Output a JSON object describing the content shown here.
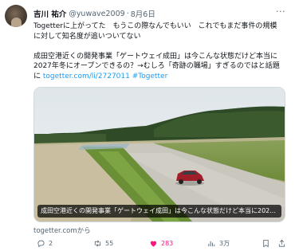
{
  "author": {
    "display_name": "吉川 祐介",
    "handle": "@yuwave2009",
    "separator": "·",
    "date": "8月6日"
  },
  "tweet": {
    "line1": "Togetterに上がってた　もうこの際なんでもいい　これでもまだ事件の規模",
    "line2": "に対して知名度が追いついてない",
    "line3": "成田空港近くの開発事業「ゲートウェイ成田」は今こんな状態だけど本当に",
    "line4": "2027年冬にオープンできるの？→むしろ「奇跡の職場」すぎるのではと話題",
    "line5_prefix": "に ",
    "link_url": "togetter.com/li/2727011",
    "hashtag": "#Togetter"
  },
  "card": {
    "caption": "成田空港近くの開発事業「ゲートウェイ成田」は今こんな状態だけど本当に202...",
    "source": "togetter.comから"
  },
  "actions": {
    "replies": "2",
    "retweets": "55",
    "likes": "283",
    "views": "3万"
  },
  "icons": {
    "more": "more-dots-icon",
    "reply": "reply-icon",
    "retweet": "retweet-icon",
    "like": "heart-filled-icon",
    "views": "views-icon",
    "bookmark": "bookmark-icon",
    "share": "share-icon"
  },
  "colors": {
    "link": "#1d9bf0",
    "like": "#f91880",
    "muted": "#536471"
  }
}
